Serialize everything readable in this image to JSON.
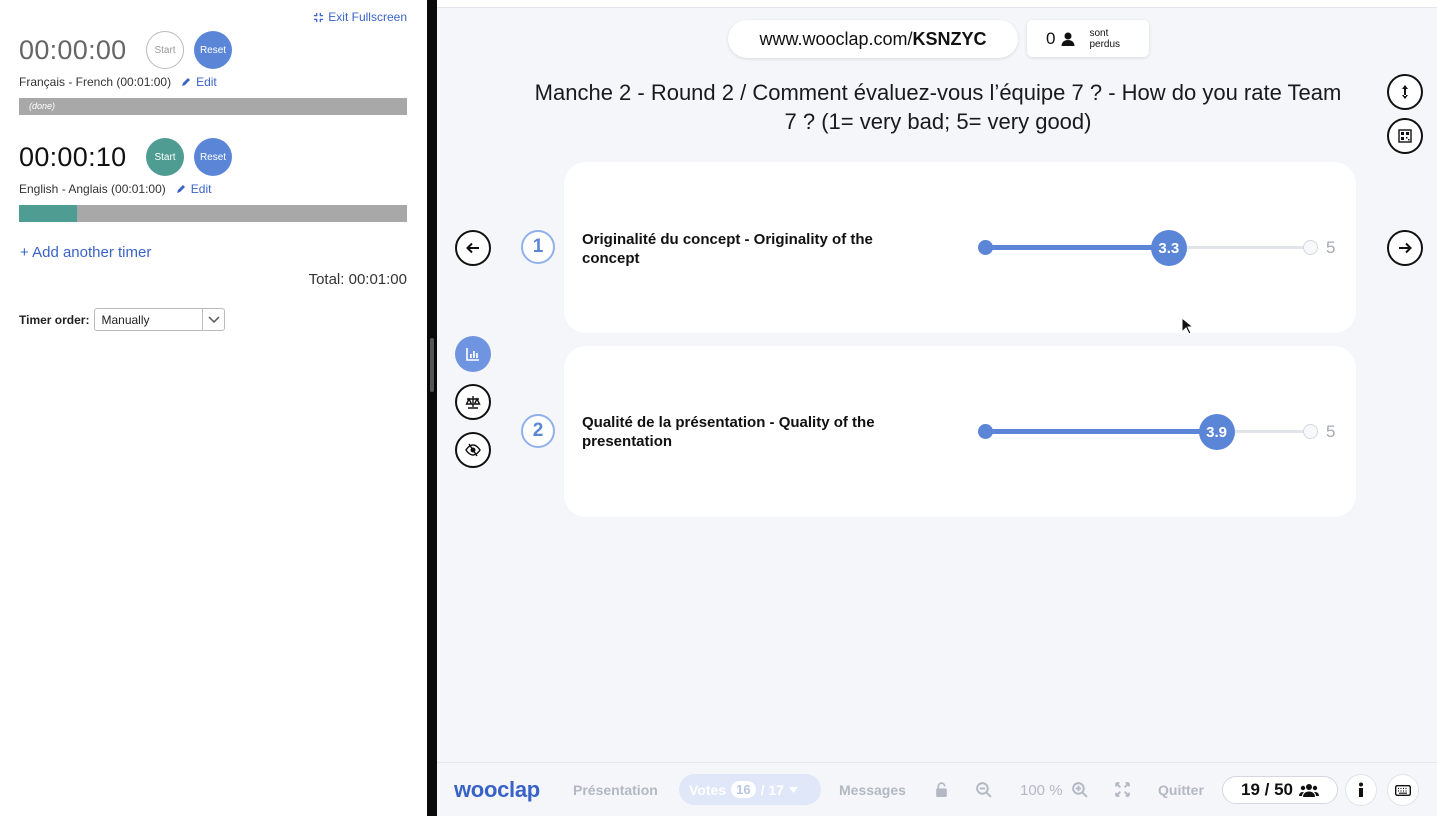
{
  "left_panel": {
    "exit_fullscreen": "Exit Fullscreen",
    "timers": [
      {
        "time": "00:00:00",
        "start_label": "Start",
        "reset_label": "Reset",
        "name": "Français - French (00:01:00)",
        "edit_label": "Edit",
        "status": "(done)",
        "progress": 1.0
      },
      {
        "time": "00:00:10",
        "start_label": "Start",
        "reset_label": "Reset",
        "name": "English - Anglais (00:01:00)",
        "edit_label": "Edit",
        "status": "",
        "progress": 0.15
      }
    ],
    "add_timer": "+ Add another timer",
    "total": "Total: 00:01:00",
    "timer_order_label": "Timer order:",
    "timer_order_value": "Manually"
  },
  "header": {
    "url_prefix": "www.wooclap.com/",
    "url_code": "KSNZYC",
    "lost_count": "0",
    "lost_label_1": "sont",
    "lost_label_2": "perdus"
  },
  "question": {
    "title": "Manche 2 - Round 2 / Comment évaluez-vous l’équipe 7 ? - How do you rate Team 7 ? (1= very bad; 5= very good)",
    "criteria": [
      {
        "number": "1",
        "label": "Originalité du concept - Originality of the concept",
        "value": "3.3",
        "max": "5"
      },
      {
        "number": "2",
        "label": "Qualité de la présentation - Quality of the presentation",
        "value": "3.9",
        "max": "5"
      }
    ]
  },
  "bottom_bar": {
    "logo": "wooclap",
    "presentation": "Présentation",
    "votes_label": "Votes",
    "votes_count": "16",
    "votes_total": "/ 17",
    "messages": "Messages",
    "zoom": "100 %",
    "quit": "Quitter",
    "pages": "19 / 50"
  },
  "colors": {
    "accent": "#5b86d8",
    "teal": "#4f9c92",
    "brand": "#3a63c8"
  }
}
